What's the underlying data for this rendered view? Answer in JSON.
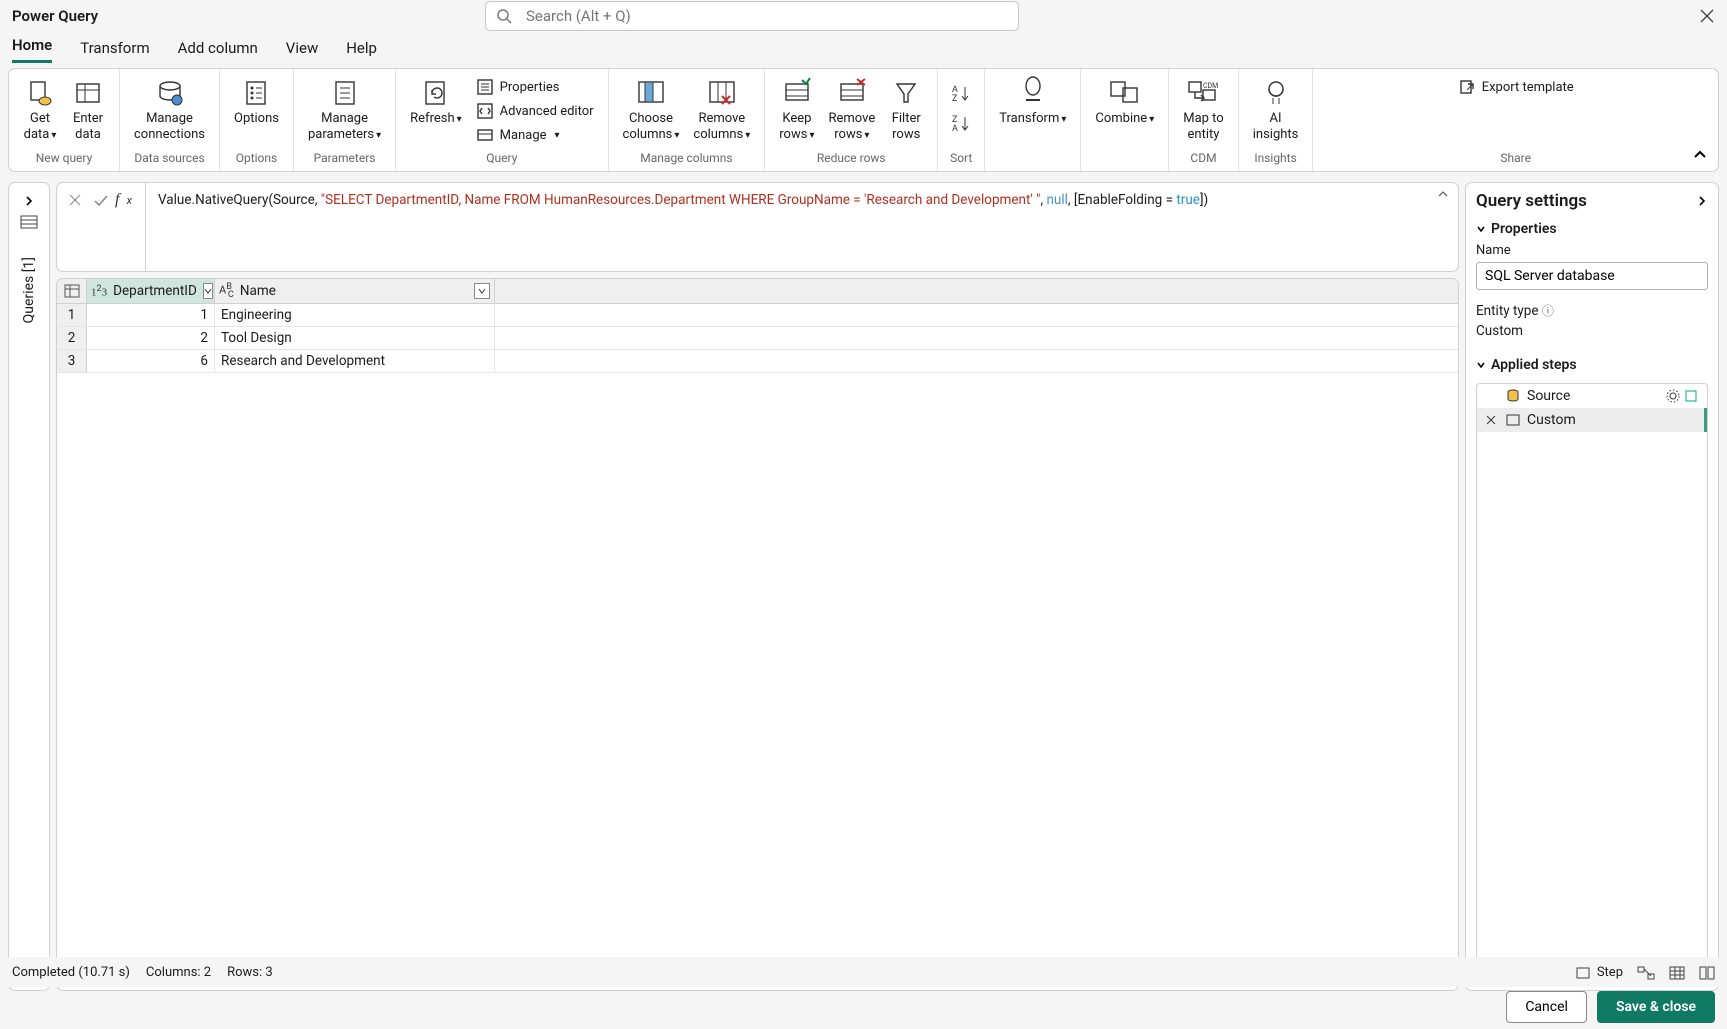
{
  "app_title": "Power Query",
  "search_placeholder": "Search (Alt + Q)",
  "tabs": [
    "Home",
    "Transform",
    "Add column",
    "View",
    "Help"
  ],
  "active_tab": 0,
  "ribbon": {
    "groups": [
      {
        "label": "New query",
        "items": [
          {
            "kind": "big",
            "label1": "Get",
            "label2": "data",
            "chev": true,
            "icon": "get-data-icon"
          },
          {
            "kind": "big",
            "label1": "Enter",
            "label2": "data",
            "icon": "enter-data-icon"
          }
        ]
      },
      {
        "label": "Data sources",
        "items": [
          {
            "kind": "big",
            "label1": "Manage",
            "label2": "connections",
            "icon": "connections-icon"
          }
        ]
      },
      {
        "label": "Options",
        "items": [
          {
            "kind": "big",
            "label1": "Options",
            "label2": "",
            "icon": "options-icon"
          }
        ]
      },
      {
        "label": "Parameters",
        "items": [
          {
            "kind": "big",
            "label1": "Manage",
            "label2": "parameters",
            "chev": true,
            "icon": "parameters-icon"
          }
        ]
      },
      {
        "label": "Query",
        "items": [
          {
            "kind": "big",
            "label1": "Refresh",
            "label2": "",
            "chev": true,
            "icon": "refresh-icon"
          },
          {
            "kind": "small",
            "rows": [
              {
                "label": "Properties",
                "icon": "properties-icon"
              },
              {
                "label": "Advanced editor",
                "icon": "editor-icon"
              },
              {
                "label": "Manage",
                "chev": true,
                "icon": "manage-icon"
              }
            ]
          }
        ]
      },
      {
        "label": "Manage columns",
        "items": [
          {
            "kind": "big",
            "label1": "Choose",
            "label2": "columns",
            "chev": true,
            "icon": "choose-cols-icon"
          },
          {
            "kind": "big",
            "label1": "Remove",
            "label2": "columns",
            "chev": true,
            "icon": "remove-cols-icon"
          }
        ]
      },
      {
        "label": "Reduce rows",
        "items": [
          {
            "kind": "big",
            "label1": "Keep",
            "label2": "rows",
            "chev": true,
            "icon": "keep-rows-icon"
          },
          {
            "kind": "big",
            "label1": "Remove",
            "label2": "rows",
            "chev": true,
            "icon": "remove-rows-icon"
          },
          {
            "kind": "big",
            "label1": "Filter",
            "label2": "rows",
            "icon": "filter-icon"
          }
        ]
      },
      {
        "label": "Sort",
        "items": [
          {
            "kind": "stack",
            "icons": [
              "sort-asc-icon",
              "sort-desc-icon"
            ]
          }
        ]
      },
      {
        "label": "",
        "items": [
          {
            "kind": "big",
            "label1": "Transform",
            "label2": "",
            "chev": true,
            "icon": "transform-icon"
          }
        ]
      },
      {
        "label": "",
        "items": [
          {
            "kind": "big",
            "label1": "Combine",
            "label2": "",
            "chev": true,
            "icon": "combine-icon"
          }
        ]
      },
      {
        "label": "CDM",
        "items": [
          {
            "kind": "big",
            "label1": "Map to",
            "label2": "entity",
            "icon": "cdm-icon"
          }
        ]
      },
      {
        "label": "Insights",
        "items": [
          {
            "kind": "big",
            "label1": "AI",
            "label2": "insights",
            "icon": "ai-icon"
          }
        ]
      },
      {
        "label": "Share",
        "items": [
          {
            "kind": "small",
            "rows": [
              {
                "label": "Export template",
                "icon": "export-icon"
              }
            ]
          }
        ]
      }
    ]
  },
  "queries_panel": {
    "label": "Queries [1]"
  },
  "formula": {
    "prefix": "Value.NativeQuery(Source, ",
    "string": "\"SELECT DepartmentID, Name FROM HumanResources.Department WHERE GroupName = 'Research and Development'  \"",
    "mid": ", ",
    "null": "null",
    "mid2": ", [EnableFolding = ",
    "true": "true",
    "suffix": "])"
  },
  "table": {
    "columns": [
      "DepartmentID",
      "Name"
    ],
    "rows": [
      {
        "n": 1,
        "DepartmentID": 1,
        "Name": "Engineering"
      },
      {
        "n": 2,
        "DepartmentID": 2,
        "Name": "Tool Design"
      },
      {
        "n": 3,
        "DepartmentID": 6,
        "Name": "Research and Development"
      }
    ]
  },
  "settings": {
    "title": "Query settings",
    "properties_label": "Properties",
    "name_label": "Name",
    "name_value": "SQL Server database",
    "entity_type_label": "Entity type",
    "entity_type_value": "Custom",
    "applied_steps_label": "Applied steps",
    "steps": [
      {
        "name": "Source",
        "icon": "db-icon",
        "gear": true,
        "ext": true
      },
      {
        "name": "Custom",
        "icon": "native-icon",
        "selected": true
      }
    ]
  },
  "status": {
    "left": "Completed (10.71 s)",
    "cols": "Columns: 2",
    "rows": "Rows: 3",
    "step_label": "Step"
  },
  "footer": {
    "cancel": "Cancel",
    "save": "Save & close"
  }
}
